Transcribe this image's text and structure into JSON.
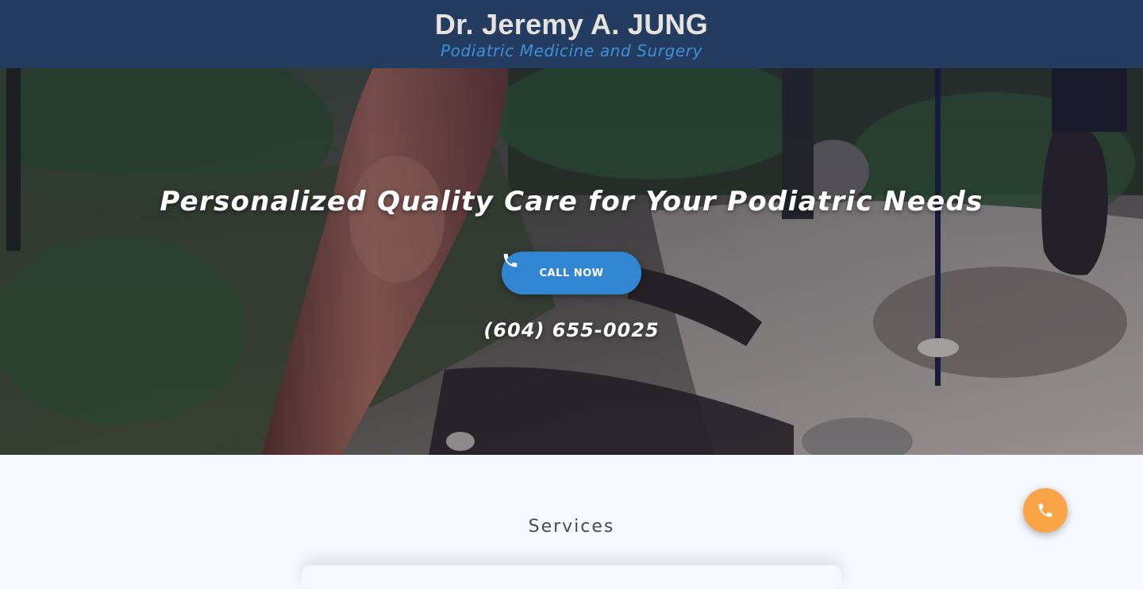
{
  "header": {
    "name": "Dr. Jeremy A. JUNG",
    "tagline": "Podiatric Medicine and Surgery"
  },
  "hero": {
    "title": "Personalized Quality Care for Your Podiatric Needs",
    "call_button_label": "CALL NOW",
    "call_button_icon": "phone-icon",
    "phone_number": "(604) 655-0025"
  },
  "services": {
    "heading": "Services"
  },
  "floating_call": {
    "icon": "phone-icon"
  },
  "colors": {
    "header_bg": "#243c5f",
    "brand_name": "#e6e2de",
    "tagline": "#3f8fd8",
    "call_button": "#3286d1",
    "fab": "#f9a447",
    "page_bg": "#f5f9fd"
  }
}
